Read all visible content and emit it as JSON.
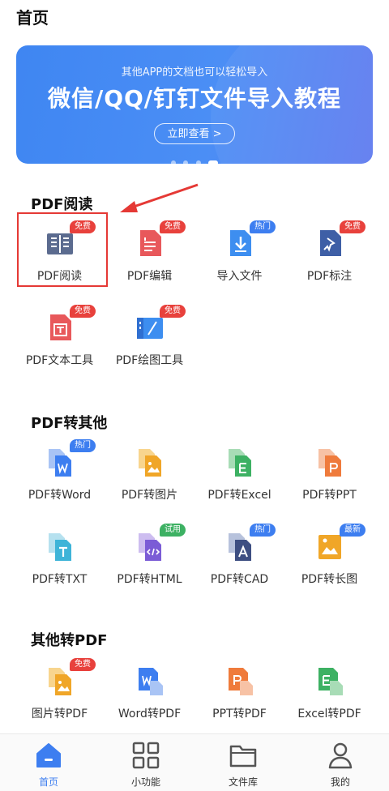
{
  "header": {
    "title": "首页"
  },
  "banner": {
    "subtitle": "其他APP的文档也可以轻松导入",
    "title": "微信/QQ/钉钉文件导入教程",
    "button_label": "立即查看 >",
    "page_count": 4,
    "active_page": 4
  },
  "sections": [
    {
      "title": "PDF阅读",
      "items": [
        {
          "label": "PDF阅读",
          "badge": "免费",
          "badge_color": "red",
          "icon": "pdf-reader-icon"
        },
        {
          "label": "PDF编辑",
          "badge": "免费",
          "badge_color": "red",
          "icon": "pdf-edit-icon"
        },
        {
          "label": "导入文件",
          "badge": "热门",
          "badge_color": "blue",
          "icon": "import-file-icon"
        },
        {
          "label": "PDF标注",
          "badge": "免费",
          "badge_color": "red",
          "icon": "pdf-annotate-icon"
        },
        {
          "label": "PDF文本工具",
          "badge": "免费",
          "badge_color": "red",
          "icon": "pdf-text-tool-icon"
        },
        {
          "label": "PDF绘图工具",
          "badge": "免费",
          "badge_color": "red",
          "icon": "pdf-draw-tool-icon"
        }
      ]
    },
    {
      "title": "PDF转其他",
      "items": [
        {
          "label": "PDF转Word",
          "badge": "热门",
          "badge_color": "blue",
          "icon": "pdf-to-word-icon"
        },
        {
          "label": "PDF转图片",
          "badge": "",
          "icon": "pdf-to-image-icon"
        },
        {
          "label": "PDF转Excel",
          "badge": "",
          "icon": "pdf-to-excel-icon"
        },
        {
          "label": "PDF转PPT",
          "badge": "",
          "icon": "pdf-to-ppt-icon"
        },
        {
          "label": "PDF转TXT",
          "badge": "",
          "icon": "pdf-to-txt-icon"
        },
        {
          "label": "PDF转HTML",
          "badge": "试用",
          "badge_color": "green",
          "icon": "pdf-to-html-icon"
        },
        {
          "label": "PDF转CAD",
          "badge": "热门",
          "badge_color": "blue",
          "icon": "pdf-to-cad-icon"
        },
        {
          "label": "PDF转长图",
          "badge": "最新",
          "badge_color": "blue",
          "icon": "pdf-to-long-image-icon"
        }
      ]
    },
    {
      "title": "其他转PDF",
      "items": [
        {
          "label": "图片转PDF",
          "badge": "免费",
          "badge_color": "red",
          "icon": "image-to-pdf-icon"
        },
        {
          "label": "Word转PDF",
          "badge": "",
          "icon": "word-to-pdf-icon"
        },
        {
          "label": "PPT转PDF",
          "badge": "",
          "icon": "ppt-to-pdf-icon"
        },
        {
          "label": "Excel转PDF",
          "badge": "",
          "icon": "excel-to-pdf-icon"
        }
      ]
    }
  ],
  "tabbar": {
    "items": [
      {
        "label": "首页",
        "icon": "home-icon",
        "active": true
      },
      {
        "label": "小功能",
        "icon": "grid-icon",
        "active": false
      },
      {
        "label": "文件库",
        "icon": "folder-icon",
        "active": false
      },
      {
        "label": "我的",
        "icon": "user-icon",
        "active": false
      }
    ]
  },
  "colors": {
    "accent": "#3d7ef0",
    "banner_start": "#3f86f2",
    "banner_end": "#5f7bf0",
    "badge_red": "#e8413c",
    "badge_green": "#3db163",
    "highlight": "#e53935"
  }
}
